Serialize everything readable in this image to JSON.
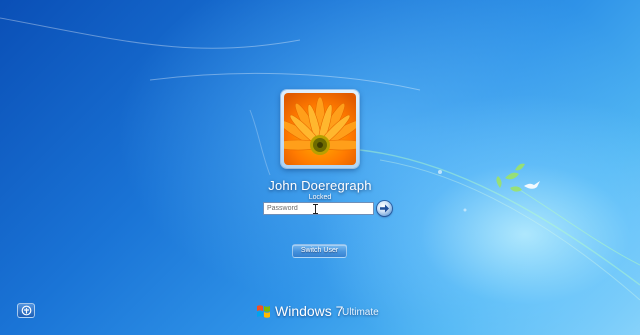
{
  "user": {
    "name": "John Doeregraph",
    "status": "Locked"
  },
  "password": {
    "placeholder": "Password"
  },
  "buttons": {
    "switch_user": "Switch User"
  },
  "branding": {
    "product": "Windows 7",
    "edition": "Ultimate"
  },
  "icons": {
    "user_tile": "gerbera-flower-picture",
    "submit": "arrow-right-icon",
    "ease_of_access": "ease-of-access-icon",
    "logo": "windows-flag-icon",
    "decoration": "bird-and-leaves"
  },
  "colors": {
    "background_deep": "#0a4fb6",
    "background_light": "#88d3fa",
    "text": "#ffffff"
  }
}
